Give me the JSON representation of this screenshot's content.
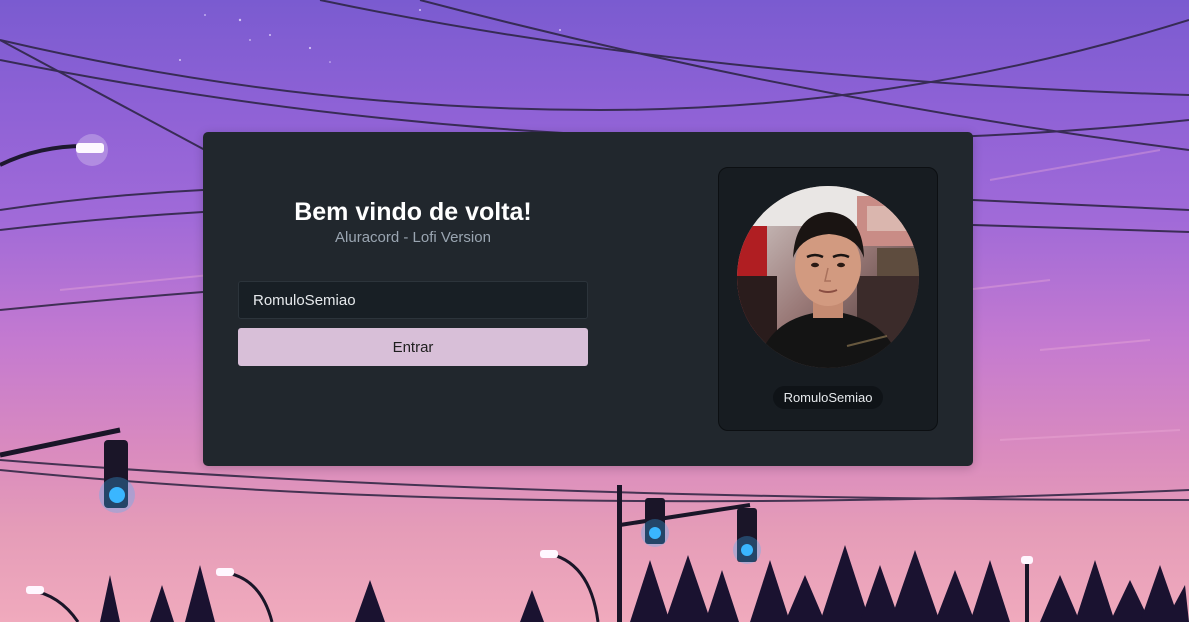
{
  "login": {
    "title": "Bem vindo de volta!",
    "subtitle": "Aluracord - Lofi Version",
    "username_value": "RomuloSemiao",
    "submit_label": "Entrar"
  },
  "profile": {
    "username": "RomuloSemiao"
  },
  "colors": {
    "card_bg": "#21272d",
    "panel_bg": "#171c21",
    "input_bg": "#181f25",
    "button_bg": "#d8bfd8",
    "title_text": "#ffffff",
    "subtitle_text": "#9aa5b1"
  }
}
